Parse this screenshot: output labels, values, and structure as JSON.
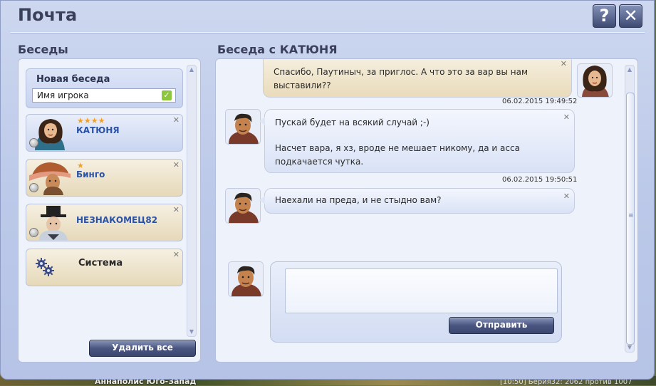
{
  "window": {
    "title": "Почта"
  },
  "left": {
    "title": "Беседы",
    "new_conversation": {
      "label": "Новая беседа",
      "input_value": "Имя игрока"
    },
    "conversations": [
      {
        "name": "КАТЮНЯ",
        "stars": "★★★★",
        "style": "blue"
      },
      {
        "name": "Бинго",
        "stars": "★",
        "style": "beige"
      },
      {
        "name": "НЕЗНАКОМЕЦ82",
        "stars": "",
        "style": "beige"
      },
      {
        "name": "Система",
        "stars": "",
        "style": "beige"
      }
    ],
    "delete_all_label": "Удалить все"
  },
  "right": {
    "title": "Беседа с КАТЮНЯ",
    "messages": [
      {
        "text": "Спасибо, Паутиныч, за приглос. А что это за вар вы нам выставили??",
        "time": "06.02.2015 19:49:52"
      },
      {
        "text_1": "Пускай будет на всякий случай ;-)",
        "text_2": "Насчет вара, я хз, вроде не мешает никому, да и асса подкачается чутка.",
        "time": "06.02.2015 19:50:51"
      },
      {
        "text": "Наехали на преда, и не стыдно вам?"
      }
    ],
    "send_label": "Отправить"
  },
  "background": {
    "left_text": "Аннаполис Юго-Запад",
    "right_text": "[10:50] Берия32: 2062 против 1007"
  },
  "colors": {
    "accent": "#2b53a5",
    "panel": "#eef2fb",
    "window": "#c3cfec"
  }
}
